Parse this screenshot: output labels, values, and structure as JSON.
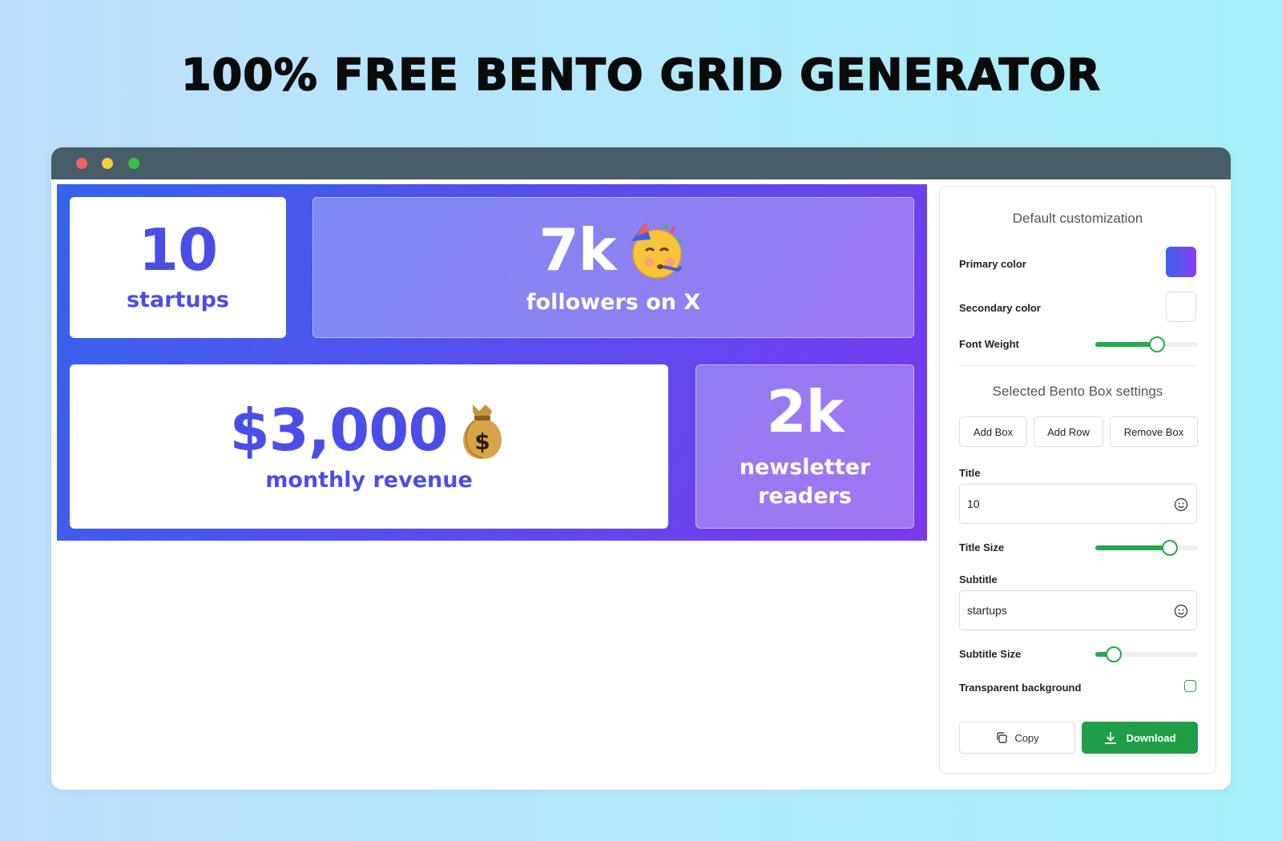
{
  "hero": {
    "title": "100% FREE BENTO GRID GENERATOR"
  },
  "bento": {
    "boxes": [
      {
        "title": "10",
        "subtitle": "startups",
        "emoji": ""
      },
      {
        "title": "7k",
        "subtitle": "followers on X",
        "emoji": "partying-face"
      },
      {
        "title": "$3,000",
        "subtitle": "monthly revenue",
        "emoji": "money-bag"
      },
      {
        "title": "2k",
        "subtitle": "newsletter readers",
        "emoji": ""
      }
    ],
    "primary_colors": [
      "#3463ec",
      "#7a38ec"
    ],
    "accent_text": "#4a4ee8"
  },
  "panel": {
    "default_heading": "Default customization",
    "primary_color_label": "Primary color",
    "secondary_color_label": "Secondary color",
    "font_weight_label": "Font Weight",
    "font_weight_value": 0.6,
    "selected_heading": "Selected Bento Box settings",
    "add_box": "Add Box",
    "add_row": "Add Row",
    "remove_box": "Remove Box",
    "title_label": "Title",
    "title_value": "10",
    "title_size_label": "Title Size",
    "title_size_value": 0.73,
    "subtitle_label": "Subtitle",
    "subtitle_value": "startups",
    "subtitle_size_label": "Subtitle Size",
    "subtitle_size_value": 0.18,
    "transparent_label": "Transparent background",
    "transparent_checked": false,
    "copy": "Copy",
    "download": "Download",
    "accent": "#22a94b"
  }
}
